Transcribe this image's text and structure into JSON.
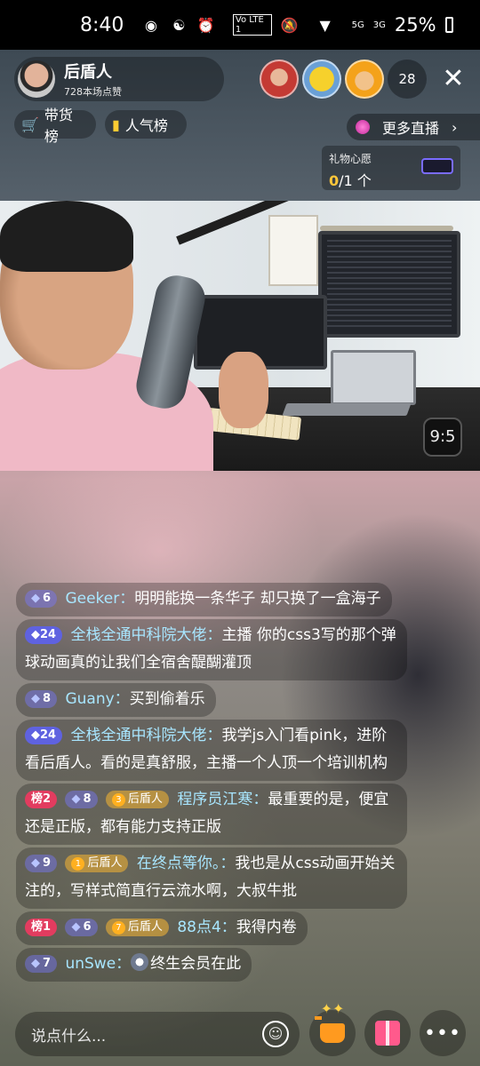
{
  "status_bar": {
    "time": "8:40",
    "icons": [
      "chat-bubble-icon",
      "wechat-icon",
      "alarm-icon",
      "volte-icon",
      "mute-icon",
      "wifi-icon",
      "signal-5g-icon",
      "signal-3g-icon"
    ],
    "volte": "Vo LTE 1",
    "net1": "5G",
    "net2": "3G",
    "battery": "25%"
  },
  "host": {
    "name": "后盾人",
    "likes": "728本场点赞"
  },
  "viewers": {
    "count": "28"
  },
  "rank_buttons": [
    {
      "label": "带货榜",
      "icon": "cart-icon"
    },
    {
      "label": "人气榜",
      "icon": "bar-chart-icon"
    }
  ],
  "more_live": {
    "label": "更多直播"
  },
  "gift_wish": {
    "title": "礼物心愿",
    "current": "0",
    "total": "/1 个"
  },
  "video": {
    "clock": "9:5"
  },
  "chat": [
    {
      "badges": [
        {
          "type": "level",
          "text": "6"
        }
      ],
      "user": "Geeker：",
      "text": "明明能换一条华子 却只换了一盒海子"
    },
    {
      "badges": [
        {
          "type": "level-blue",
          "text": "24"
        }
      ],
      "user": "全栈全通中科院大佬：",
      "text": "主播 你的css3写的那个弹球动画真的让我们全宿舍醍醐灌顶"
    },
    {
      "badges": [
        {
          "type": "level",
          "text": "8"
        }
      ],
      "user": "Guany：",
      "text": "买到偷着乐"
    },
    {
      "badges": [
        {
          "type": "level-blue",
          "text": "24"
        }
      ],
      "user": "全栈全通中科院大佬：",
      "text": "我学js入门看pink，进阶看后盾人。看的是真舒服，主播一个人顶一个培训机构"
    },
    {
      "badges": [
        {
          "type": "rank",
          "text": "榜2"
        },
        {
          "type": "level",
          "text": "8"
        },
        {
          "type": "fan",
          "num": "3",
          "text": "后盾人"
        }
      ],
      "user": "程序员江寒：",
      "text": "最重要的是，便宜还是正版，都有能力支持正版"
    },
    {
      "badges": [
        {
          "type": "level",
          "text": "9"
        },
        {
          "type": "fan",
          "num": "1",
          "text": "后盾人"
        }
      ],
      "user": "在终点等你。：",
      "text": "我也是从css动画开始关注的，写样式简直行云流水啊，大叔牛批"
    },
    {
      "badges": [
        {
          "type": "rank",
          "text": "榜1"
        },
        {
          "type": "level",
          "text": "6"
        },
        {
          "type": "fan",
          "num": "7",
          "text": "后盾人"
        }
      ],
      "user": "88点4：",
      "text": "我得内卷"
    },
    {
      "badges": [
        {
          "type": "level",
          "text": "7"
        }
      ],
      "user": "unSwe：",
      "text": "终生会员在此",
      "emoji": "cat-icon"
    }
  ],
  "input": {
    "placeholder": "说点什么..."
  },
  "colors": {
    "username": "#a8e6ff",
    "rank_badge": "#e23c5f",
    "fan_badge": "#d2a03c",
    "level_badge_blue": "#5f62e0",
    "accent_yellow": "#ffcc33"
  }
}
